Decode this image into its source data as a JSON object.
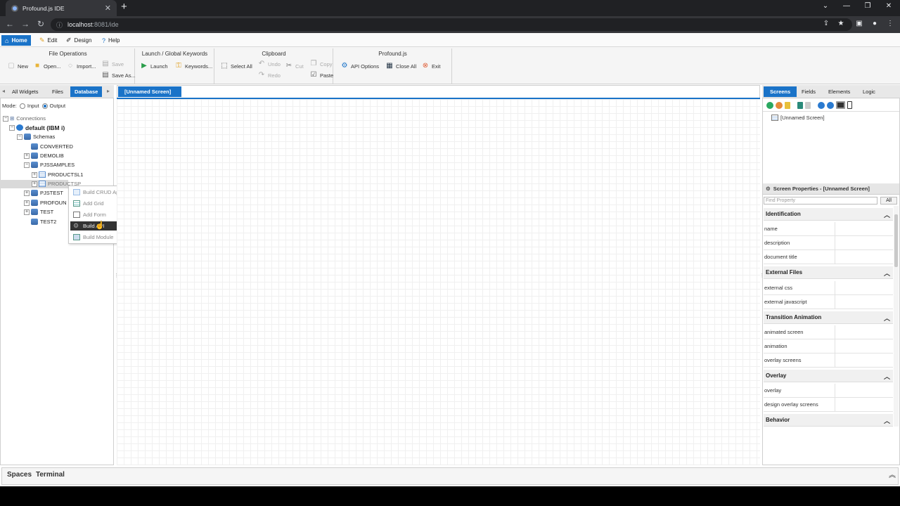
{
  "browser": {
    "tab_title": "Profound.js IDE",
    "url_host": "localhost",
    "url_rest": ":8081/ide"
  },
  "menu": {
    "tabs": [
      {
        "label": "Home",
        "icon": "home-icon"
      },
      {
        "label": "Edit",
        "icon": "pencil-icon"
      },
      {
        "label": "Design",
        "icon": "design-icon"
      },
      {
        "label": "Help",
        "icon": "help-icon"
      }
    ]
  },
  "ribbon": {
    "file_operations": {
      "title": "File Operations",
      "new": "New",
      "open": "Open...",
      "import": "Import...",
      "save": "Save",
      "save_as": "Save As..."
    },
    "launch": {
      "title": "Launch / Global Keywords",
      "launch": "Launch",
      "keywords": "Keywords..."
    },
    "clipboard": {
      "title": "Clipboard",
      "select_all": "Select All",
      "undo": "Undo",
      "redo": "Redo",
      "cut": "Cut",
      "copy": "Copy",
      "paste": "Paste"
    },
    "profoundjs": {
      "title": "Profound.js",
      "api_options": "API Options",
      "close_all": "Close All",
      "exit": "Exit"
    }
  },
  "left_panel": {
    "tabs": [
      "All Widgets",
      "Files",
      "Database"
    ],
    "active_tab": "Database",
    "mode_label": "Mode:",
    "mode_input": "Input",
    "mode_output": "Output",
    "tree": {
      "connections": "Connections",
      "default": "default (IBM i)",
      "schemas": "Schemas",
      "items": [
        "CONVERTED",
        "DEMOLIB",
        "PJSSAMPLES"
      ],
      "sub_items": [
        "PRODUCTSL1",
        "PRODUCTSP"
      ],
      "items_after": [
        "PJSTEST",
        "PROFOUN",
        "TEST",
        "TEST2"
      ]
    }
  },
  "context_menu": {
    "items": [
      {
        "label": "Build CRUD App"
      },
      {
        "label": "Add Grid"
      },
      {
        "label": "Add Form"
      },
      {
        "label": "Build API"
      },
      {
        "label": "Build Module"
      }
    ],
    "active_index": 3
  },
  "center": {
    "doc_tab": "[Unnamed Screen]"
  },
  "right_panel": {
    "tabs": [
      "Screens",
      "Fields",
      "Elements",
      "Logic"
    ],
    "active_tab": "Screens",
    "screen_item": "[Unnamed Screen]",
    "props_title": "Screen Properties - [Unnamed Screen]",
    "find_placeholder": "Find Property",
    "all_button": "All",
    "sections": [
      {
        "title": "Identification",
        "rows": [
          "name",
          "description",
          "document title"
        ]
      },
      {
        "title": "External Files",
        "rows": [
          "external css",
          "external javascript"
        ]
      },
      {
        "title": "Transition Animation",
        "rows": [
          "animated screen",
          "animation",
          "overlay screens"
        ]
      },
      {
        "title": "Overlay",
        "rows": [
          "overlay",
          "design overlay screens"
        ]
      },
      {
        "title": "Behavior",
        "rows": []
      }
    ]
  },
  "bottom": {
    "tabs": [
      "Spaces",
      "Terminal"
    ]
  },
  "colors": {
    "accent": "#1a73c8",
    "browser_dark": "#202124"
  }
}
